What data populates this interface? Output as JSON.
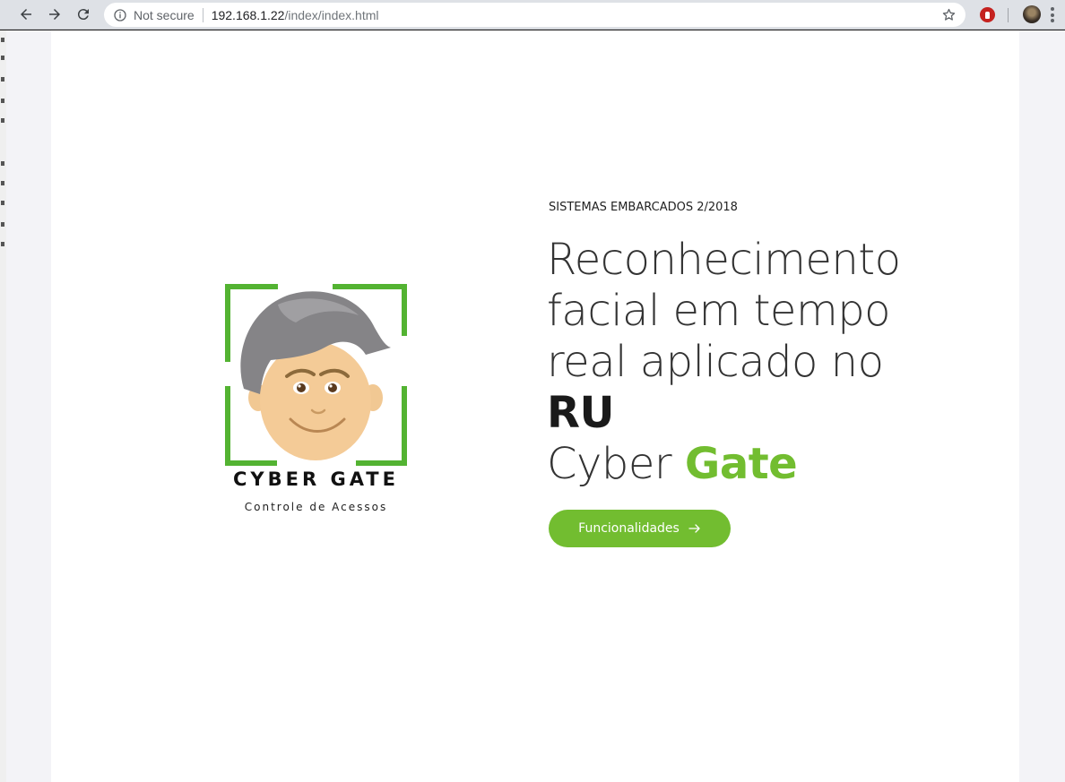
{
  "browser": {
    "security_label": "Not secure",
    "url_host": "192.168.1.22",
    "url_path": "/index/index.html"
  },
  "logo": {
    "title": "CYBER GATE",
    "subtitle": "Controle de Acessos"
  },
  "hero": {
    "eyebrow": "SISTEMAS EMBARCADOS 2/2018",
    "title_line_1": "Reconhecimento",
    "title_line_2": "facial em tempo",
    "title_line_3": "real aplicado no",
    "title_strong": "RU",
    "brand_first": "Cyber ",
    "brand_accent": "Gate",
    "cta_label": "Funcionalidades"
  },
  "colors": {
    "accent": "#72bd30",
    "text_dark": "#1a1a1a",
    "chrome_bg": "#dee1e6"
  }
}
